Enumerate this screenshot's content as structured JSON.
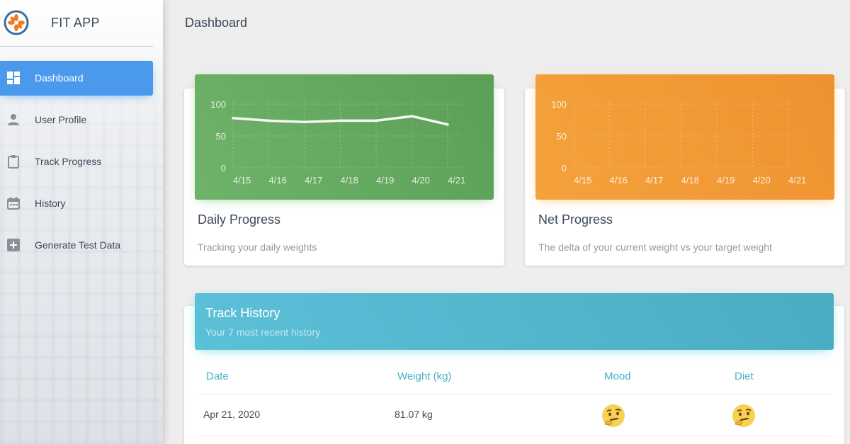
{
  "app": {
    "name": "FIT APP",
    "logo_icon": "app-logo-icon"
  },
  "sidebar": {
    "items": [
      {
        "label": "Dashboard",
        "icon": "dashboard-icon",
        "active": true
      },
      {
        "label": "User Profile",
        "icon": "person-icon",
        "active": false
      },
      {
        "label": "Track Progress",
        "icon": "clipboard-icon",
        "active": false
      },
      {
        "label": "History",
        "icon": "calendar-icon",
        "active": false
      },
      {
        "label": "Generate Test Data",
        "icon": "plus-box-icon",
        "active": false
      }
    ]
  },
  "page": {
    "title": "Dashboard"
  },
  "cards": {
    "daily": {
      "title": "Daily Progress",
      "subtitle": "Tracking your daily weights",
      "color": "#5fa65a"
    },
    "net": {
      "title": "Net Progress",
      "subtitle": "The delta of your current weight vs your target weight",
      "color": "#f09a33"
    }
  },
  "chart_data": [
    {
      "type": "line",
      "x": [
        "4/15",
        "4/16",
        "4/17",
        "4/18",
        "4/19",
        "4/20",
        "4/21"
      ],
      "y_ticks": [
        "100",
        "50",
        "0"
      ],
      "ylim": [
        0,
        100
      ],
      "series": [
        {
          "values": [
            78,
            74,
            72,
            74,
            74,
            81,
            68
          ]
        }
      ],
      "grid": true
    },
    {
      "type": "line",
      "x": [
        "4/15",
        "4/16",
        "4/17",
        "4/18",
        "4/19",
        "4/20",
        "4/21"
      ],
      "y_ticks": [
        "100",
        "50",
        "0"
      ],
      "ylim": [
        0,
        100
      ],
      "series": [],
      "grid": true
    }
  ],
  "history": {
    "title": "Track History",
    "subtitle": "Your 7 most recent history",
    "columns": [
      "Date",
      "Weight (kg)",
      "Mood",
      "Diet"
    ],
    "rows": [
      {
        "date": "Apr 21, 2020",
        "weight": "81.07 kg",
        "mood": "thinking-face",
        "diet": "thinking-face"
      }
    ],
    "header_color": "#52b7cf"
  }
}
